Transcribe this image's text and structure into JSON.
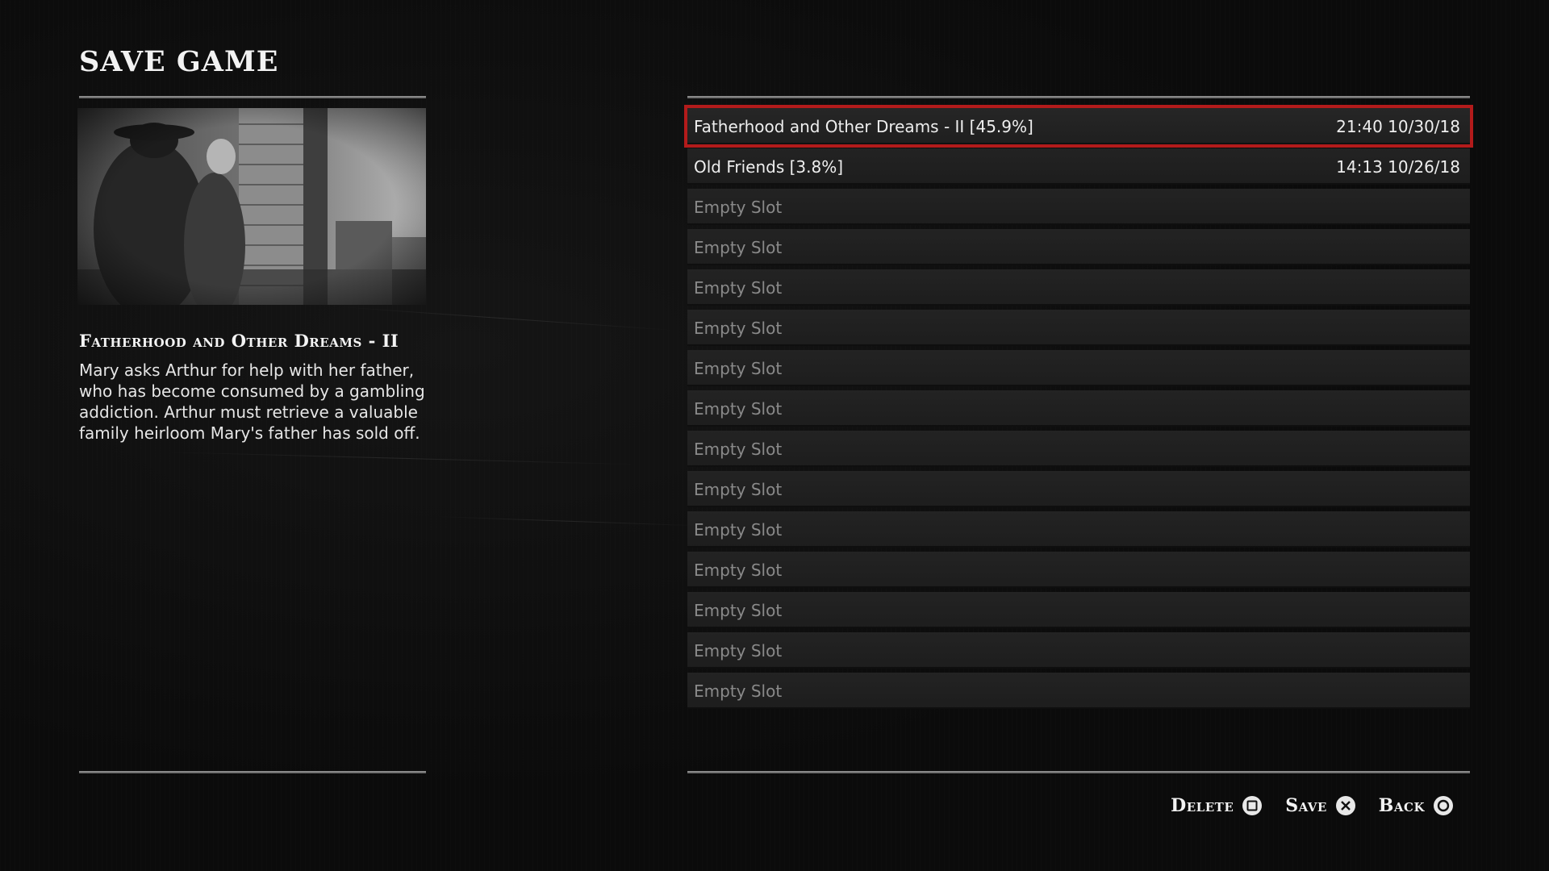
{
  "screen": {
    "title": "SAVE GAME"
  },
  "details": {
    "mission_title": "Fatherhood and Other Dreams - II",
    "mission_description": "Mary asks Arthur for help with her father, who has become consumed by a gambling addiction. Arthur must retrieve a valuable family heirloom Mary's father has sold off."
  },
  "slots": [
    {
      "name": "Fatherhood and Other Dreams - II [45.9%]",
      "date": "21:40 10/30/18",
      "state": "filled",
      "selected": true
    },
    {
      "name": "Old Friends [3.8%]",
      "date": "14:13 10/26/18",
      "state": "filled",
      "selected": false
    },
    {
      "name": "Empty Slot",
      "date": "",
      "state": "empty",
      "selected": false
    },
    {
      "name": "Empty Slot",
      "date": "",
      "state": "empty",
      "selected": false
    },
    {
      "name": "Empty Slot",
      "date": "",
      "state": "empty",
      "selected": false
    },
    {
      "name": "Empty Slot",
      "date": "",
      "state": "empty",
      "selected": false
    },
    {
      "name": "Empty Slot",
      "date": "",
      "state": "empty",
      "selected": false
    },
    {
      "name": "Empty Slot",
      "date": "",
      "state": "empty",
      "selected": false
    },
    {
      "name": "Empty Slot",
      "date": "",
      "state": "empty",
      "selected": false
    },
    {
      "name": "Empty Slot",
      "date": "",
      "state": "empty",
      "selected": false
    },
    {
      "name": "Empty Slot",
      "date": "",
      "state": "empty",
      "selected": false
    },
    {
      "name": "Empty Slot",
      "date": "",
      "state": "empty",
      "selected": false
    },
    {
      "name": "Empty Slot",
      "date": "",
      "state": "empty",
      "selected": false
    },
    {
      "name": "Empty Slot",
      "date": "",
      "state": "empty",
      "selected": false
    },
    {
      "name": "Empty Slot",
      "date": "",
      "state": "empty",
      "selected": false
    }
  ],
  "prompts": {
    "delete": {
      "label": "Delete",
      "icon": "square-button-icon"
    },
    "save": {
      "label": "Save",
      "icon": "cross-button-icon"
    },
    "back": {
      "label": "Back",
      "icon": "circle-button-icon"
    }
  },
  "colors": {
    "selection_outline": "#b31b1b",
    "background": "#0b0b0b",
    "slot_background": "#212121",
    "empty_text": "#8a8a8a"
  }
}
